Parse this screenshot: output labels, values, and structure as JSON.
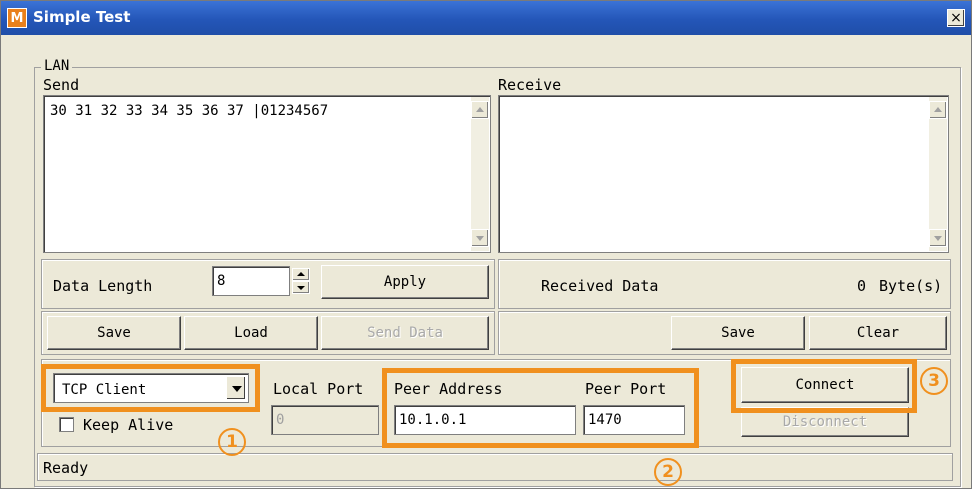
{
  "window": {
    "title": "Simple Test",
    "icon_letter": "M",
    "close_glyph": "×"
  },
  "group": {
    "label": "LAN"
  },
  "send": {
    "label": "Send",
    "content": "30 31 32 33 34 35 36 37 |01234567"
  },
  "receive": {
    "label": "Receive",
    "content": ""
  },
  "data_length": {
    "label": "Data Length",
    "value": "8",
    "apply_label": "Apply"
  },
  "received_info": {
    "label": "Received Data",
    "count": "0",
    "unit": "Byte(s)"
  },
  "send_buttons": {
    "save": "Save",
    "load": "Load",
    "send_data": "Send Data"
  },
  "receive_buttons": {
    "save": "Save",
    "clear": "Clear"
  },
  "connection": {
    "mode": "TCP Client",
    "keep_alive_label": "Keep Alive",
    "keep_alive_checked": false,
    "local_port_label": "Local Port",
    "local_port_value": "0",
    "peer_address_label": "Peer Address",
    "peer_address_value": "10.1.0.1",
    "peer_port_label": "Peer Port",
    "peer_port_value": "1470",
    "connect_label": "Connect",
    "disconnect_label": "Disconnect"
  },
  "status": {
    "text": "Ready"
  },
  "annotations": {
    "one": "1",
    "two": "2",
    "three": "3",
    "color": "#f0901e"
  }
}
